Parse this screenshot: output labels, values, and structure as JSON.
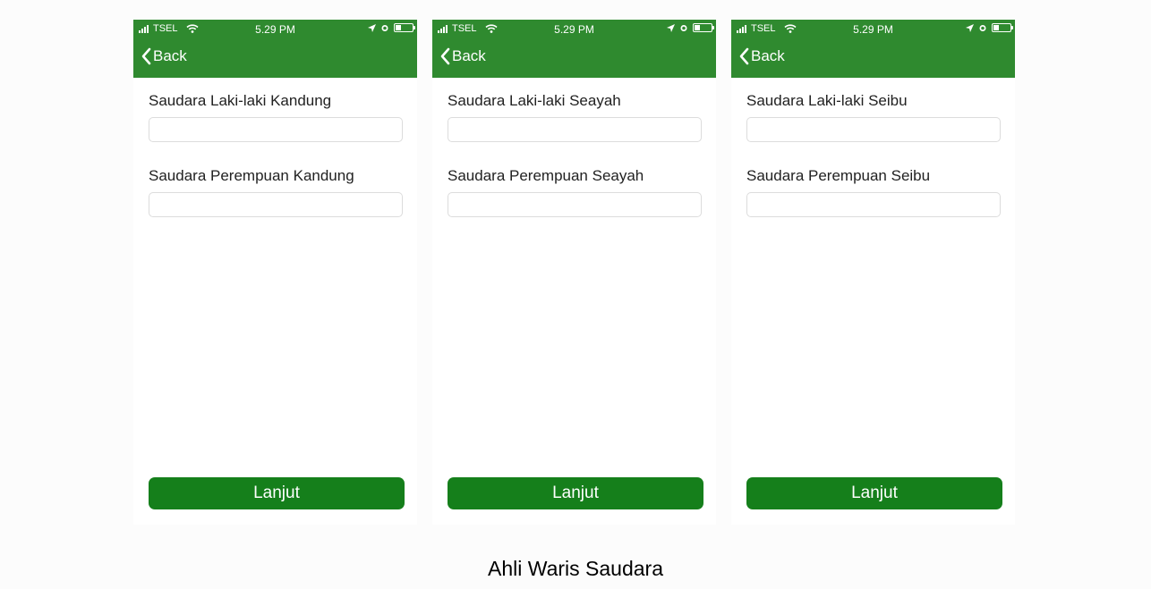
{
  "caption": "Ahli Waris Saudara",
  "colors": {
    "header": "#2f8a2f",
    "button": "#157f1b"
  },
  "status_bar": {
    "carrier": "TSEL",
    "time": "5.29 PM",
    "battery_level": 0.35
  },
  "nav": {
    "back_label": "Back",
    "back_icon": "chevron-left-icon"
  },
  "screens": [
    {
      "fields": [
        {
          "label": "Saudara Laki-laki Kandung",
          "value": "",
          "placeholder": ""
        },
        {
          "label": "Saudara Perempuan Kandung",
          "value": "",
          "placeholder": ""
        }
      ],
      "button_label": "Lanjut"
    },
    {
      "fields": [
        {
          "label": "Saudara Laki-laki Seayah",
          "value": "",
          "placeholder": ""
        },
        {
          "label": "Saudara Perempuan Seayah",
          "value": "",
          "placeholder": ""
        }
      ],
      "button_label": "Lanjut"
    },
    {
      "fields": [
        {
          "label": "Saudara Laki-laki Seibu",
          "value": "",
          "placeholder": ""
        },
        {
          "label": "Saudara Perempuan Seibu",
          "value": "",
          "placeholder": ""
        }
      ],
      "button_label": "Lanjut"
    }
  ]
}
